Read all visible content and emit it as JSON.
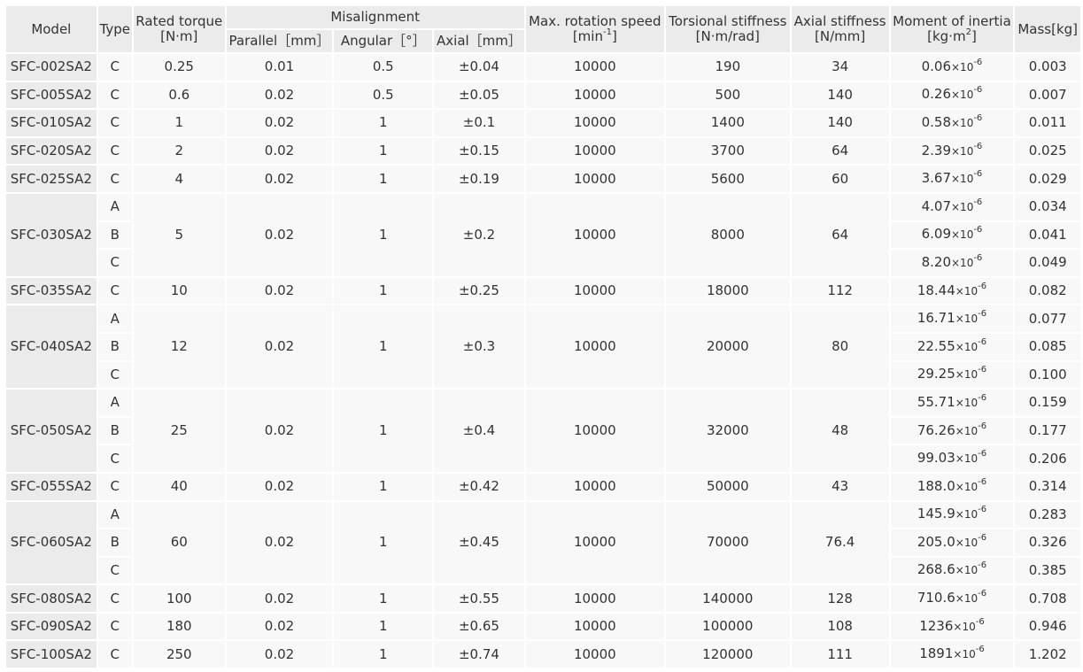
{
  "headers": {
    "model": "Model",
    "type": "Type",
    "rated_torque": [
      "Rated torque",
      "[N·m]"
    ],
    "misalignment": "Misalignment",
    "parallel": "Parallel［mm］",
    "angular": "Angular［°］",
    "axial": "Axial［mm］",
    "max_speed": [
      "Max. rotation speed",
      "[min",
      "-1",
      "]"
    ],
    "torsional": [
      "Torsional stiffness",
      "[N·m/rad]"
    ],
    "axial_stiffness": [
      "Axial stiffness",
      "[N/mm]"
    ],
    "inertia": [
      "Moment of inertia",
      "[kg·m",
      "2",
      "]"
    ],
    "mass": "Mass[kg]"
  },
  "inertia_exponent": "-6",
  "inertia_times": "×10",
  "models": [
    {
      "model": "SFC-002SA2",
      "torque": "0.25",
      "parallel": "0.01",
      "angular": "0.5",
      "axial": "±0.04",
      "speed": "10000",
      "torsional": "190",
      "axial_stiffness": "34",
      "variants": [
        {
          "type": "C",
          "inertia": "0.06",
          "mass": "0.003"
        }
      ]
    },
    {
      "model": "SFC-005SA2",
      "torque": "0.6",
      "parallel": "0.02",
      "angular": "0.5",
      "axial": "±0.05",
      "speed": "10000",
      "torsional": "500",
      "axial_stiffness": "140",
      "variants": [
        {
          "type": "C",
          "inertia": "0.26",
          "mass": "0.007"
        }
      ]
    },
    {
      "model": "SFC-010SA2",
      "torque": "1",
      "parallel": "0.02",
      "angular": "1",
      "axial": "±0.1",
      "speed": "10000",
      "torsional": "1400",
      "axial_stiffness": "140",
      "variants": [
        {
          "type": "C",
          "inertia": "0.58",
          "mass": "0.011"
        }
      ]
    },
    {
      "model": "SFC-020SA2",
      "torque": "2",
      "parallel": "0.02",
      "angular": "1",
      "axial": "±0.15",
      "speed": "10000",
      "torsional": "3700",
      "axial_stiffness": "64",
      "variants": [
        {
          "type": "C",
          "inertia": "2.39",
          "mass": "0.025"
        }
      ]
    },
    {
      "model": "SFC-025SA2",
      "torque": "4",
      "parallel": "0.02",
      "angular": "1",
      "axial": "±0.19",
      "speed": "10000",
      "torsional": "5600",
      "axial_stiffness": "60",
      "variants": [
        {
          "type": "C",
          "inertia": "3.67",
          "mass": "0.029"
        }
      ]
    },
    {
      "model": "SFC-030SA2",
      "torque": "5",
      "parallel": "0.02",
      "angular": "1",
      "axial": "±0.2",
      "speed": "10000",
      "torsional": "8000",
      "axial_stiffness": "64",
      "variants": [
        {
          "type": "A",
          "inertia": "4.07",
          "mass": "0.034"
        },
        {
          "type": "B",
          "inertia": "6.09",
          "mass": "0.041"
        },
        {
          "type": "C",
          "inertia": "8.20",
          "mass": "0.049"
        }
      ]
    },
    {
      "model": "SFC-035SA2",
      "torque": "10",
      "parallel": "0.02",
      "angular": "1",
      "axial": "±0.25",
      "speed": "10000",
      "torsional": "18000",
      "axial_stiffness": "112",
      "variants": [
        {
          "type": "C",
          "inertia": "18.44",
          "mass": "0.082"
        }
      ]
    },
    {
      "model": "SFC-040SA2",
      "torque": "12",
      "parallel": "0.02",
      "angular": "1",
      "axial": "±0.3",
      "speed": "10000",
      "torsional": "20000",
      "axial_stiffness": "80",
      "variants": [
        {
          "type": "A",
          "inertia": "16.71",
          "mass": "0.077"
        },
        {
          "type": "B",
          "inertia": "22.55",
          "mass": "0.085"
        },
        {
          "type": "C",
          "inertia": "29.25",
          "mass": "0.100"
        }
      ]
    },
    {
      "model": "SFC-050SA2",
      "torque": "25",
      "parallel": "0.02",
      "angular": "1",
      "axial": "±0.4",
      "speed": "10000",
      "torsional": "32000",
      "axial_stiffness": "48",
      "variants": [
        {
          "type": "A",
          "inertia": "55.71",
          "mass": "0.159"
        },
        {
          "type": "B",
          "inertia": "76.26",
          "mass": "0.177"
        },
        {
          "type": "C",
          "inertia": "99.03",
          "mass": "0.206"
        }
      ]
    },
    {
      "model": "SFC-055SA2",
      "torque": "40",
      "parallel": "0.02",
      "angular": "1",
      "axial": "±0.42",
      "speed": "10000",
      "torsional": "50000",
      "axial_stiffness": "43",
      "variants": [
        {
          "type": "C",
          "inertia": "188.0",
          "mass": "0.314"
        }
      ]
    },
    {
      "model": "SFC-060SA2",
      "torque": "60",
      "parallel": "0.02",
      "angular": "1",
      "axial": "±0.45",
      "speed": "10000",
      "torsional": "70000",
      "axial_stiffness": "76.4",
      "variants": [
        {
          "type": "A",
          "inertia": "145.9",
          "mass": "0.283"
        },
        {
          "type": "B",
          "inertia": "205.0",
          "mass": "0.326"
        },
        {
          "type": "C",
          "inertia": "268.6",
          "mass": "0.385"
        }
      ]
    },
    {
      "model": "SFC-080SA2",
      "torque": "100",
      "parallel": "0.02",
      "angular": "1",
      "axial": "±0.55",
      "speed": "10000",
      "torsional": "140000",
      "axial_stiffness": "128",
      "variants": [
        {
          "type": "C",
          "inertia": "710.6",
          "mass": "0.708"
        }
      ]
    },
    {
      "model": "SFC-090SA2",
      "torque": "180",
      "parallel": "0.02",
      "angular": "1",
      "axial": "±0.65",
      "speed": "10000",
      "torsional": "100000",
      "axial_stiffness": "108",
      "variants": [
        {
          "type": "C",
          "inertia": "1236",
          "mass": "0.946"
        }
      ]
    },
    {
      "model": "SFC-100SA2",
      "torque": "250",
      "parallel": "0.02",
      "angular": "1",
      "axial": "±0.74",
      "speed": "10000",
      "torsional": "120000",
      "axial_stiffness": "111",
      "variants": [
        {
          "type": "C",
          "inertia": "1891",
          "mass": "1.202"
        }
      ]
    }
  ]
}
